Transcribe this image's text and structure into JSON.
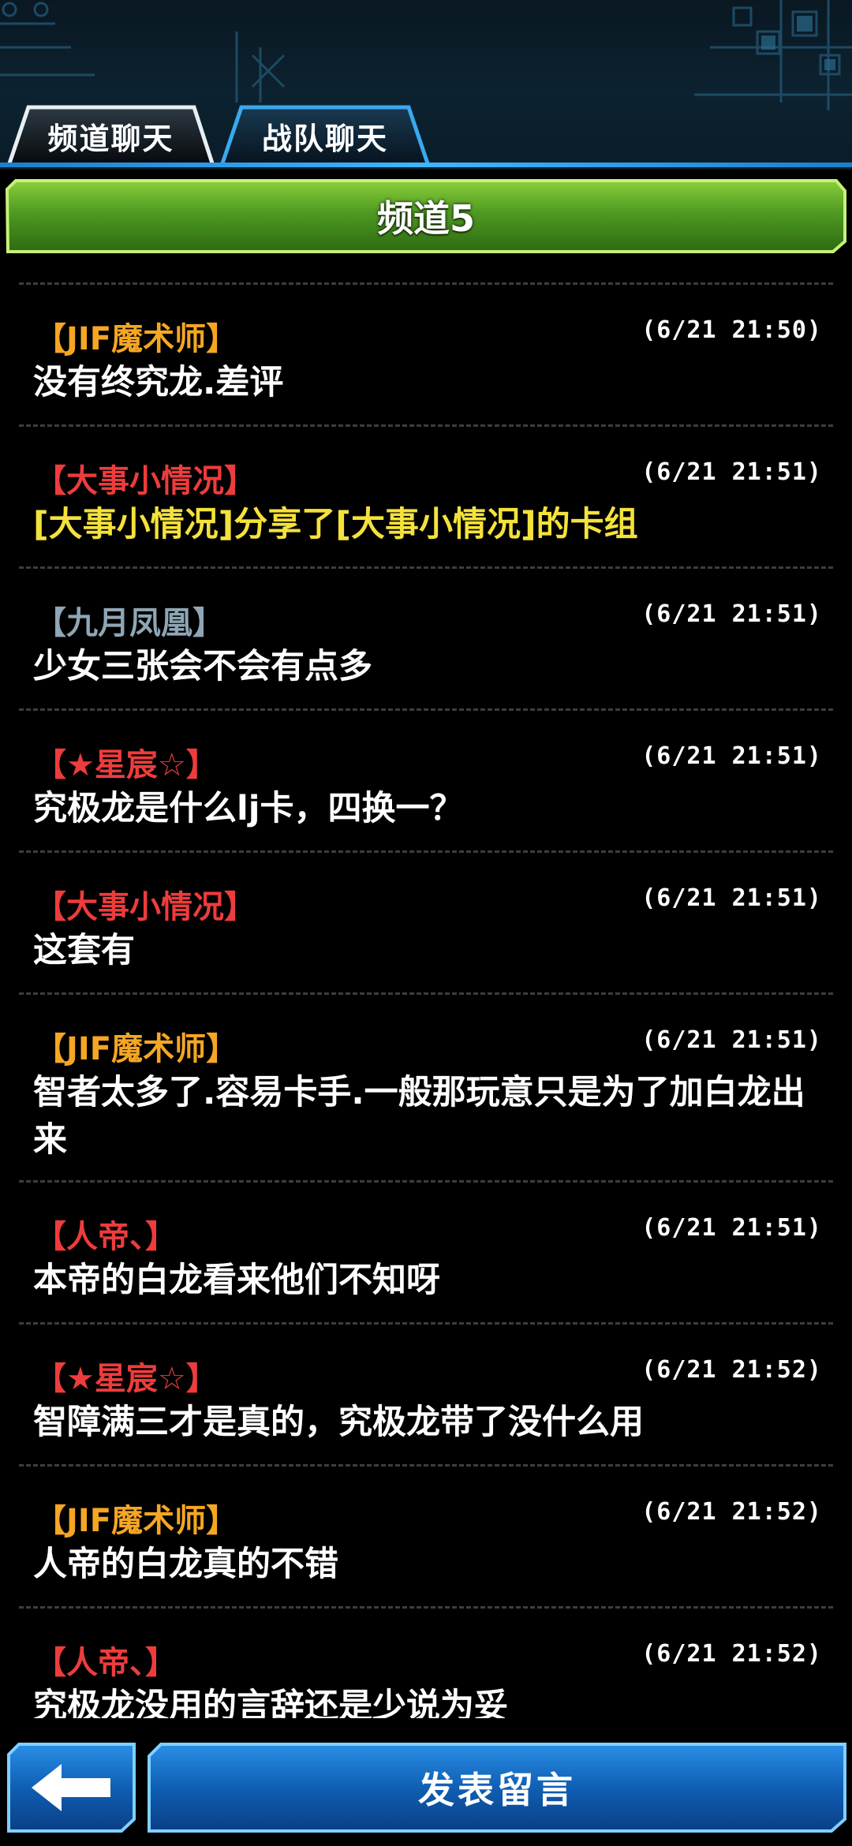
{
  "tabs": [
    {
      "label": "频道聊天",
      "active": true
    },
    {
      "label": "战队聊天",
      "active": false
    }
  ],
  "channel": {
    "title": "频道5"
  },
  "colors": {
    "accent_blue": "#1e8fe0",
    "channel_green": "#5aa22a",
    "name_orange": "#f5a623",
    "name_red": "#ee3c3c",
    "name_gray": "#8fa6b4",
    "share_yellow": "#f4e23c"
  },
  "messages": [
    {
      "name": "【JIF魔术师】",
      "time": "(6/21 21:50)",
      "text": "没有终究龙.差评"
    },
    {
      "name": "【大事小情况】",
      "time": "(6/21 21:51)",
      "text": "[大事小情况]分享了[大事小情况]的卡组"
    },
    {
      "name": "【九月凤凰】",
      "time": "(6/21 21:51)",
      "text": "少女三张会不会有点多"
    },
    {
      "name": "【★星宸☆】",
      "time": "(6/21 21:51)",
      "text": "究极龙是什么lj卡，四换一？"
    },
    {
      "name": "【大事小情况】",
      "time": "(6/21 21:51)",
      "text": "这套有"
    },
    {
      "name": "【JIF魔术师】",
      "time": "(6/21 21:51)",
      "text": "智者太多了.容易卡手.一般那玩意只是为了加白龙出来"
    },
    {
      "name": "【人帝、】",
      "time": "(6/21 21:51)",
      "text": "本帝的白龙看来他们不知呀"
    },
    {
      "name": "【★星宸☆】",
      "time": "(6/21 21:52)",
      "text": "智障满三才是真的，究极龙带了没什么用"
    },
    {
      "name": "【JIF魔术师】",
      "time": "(6/21 21:52)",
      "text": "人帝的白龙真的不错"
    },
    {
      "name": "【人帝、】",
      "time": "(6/21 21:52)",
      "text": "究极龙没用的言辞还是少说为妥"
    }
  ],
  "bottom": {
    "back_icon": "arrow-left-icon",
    "post_label": "发表留言"
  }
}
